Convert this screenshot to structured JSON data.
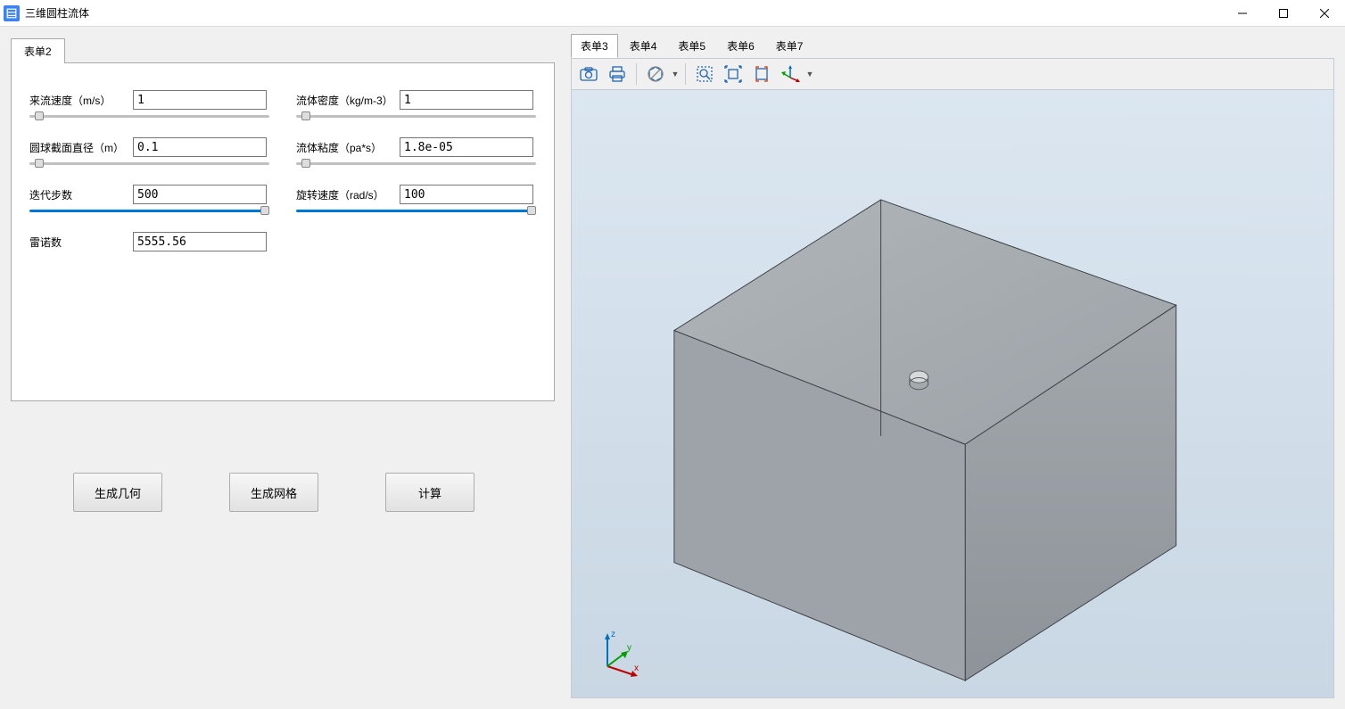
{
  "window": {
    "title": "三维圆柱流体"
  },
  "leftTab": {
    "label": "表单2"
  },
  "fields": {
    "velocity": {
      "label": "来流速度（m/s）",
      "value": "1",
      "sliderPos": "4%",
      "active": false
    },
    "density": {
      "label": "流体密度（kg/m-3）",
      "value": "1",
      "sliderPos": "4%",
      "active": false
    },
    "diameter": {
      "label": "圆球截面直径（m）",
      "value": "0.1",
      "sliderPos": "4%",
      "active": false
    },
    "viscosity": {
      "label": "流体粘度（pa*s）",
      "value": "1.8e-05",
      "sliderPos": "4%",
      "active": false
    },
    "iterations": {
      "label": "迭代步数",
      "value": "500",
      "sliderPos": "98%",
      "active": true
    },
    "rotation": {
      "label": "旋转速度（rad/s）",
      "value": "100",
      "sliderPos": "98%",
      "active": true
    },
    "reynolds": {
      "label": "雷诺数",
      "value": "5555.56"
    }
  },
  "buttons": {
    "genGeometry": "生成几何",
    "genMesh": "生成网格",
    "compute": "计算"
  },
  "rightTabs": [
    "表单3",
    "表单4",
    "表单5",
    "表单6",
    "表单7"
  ],
  "activeRightTab": 0,
  "axes": {
    "x": "x",
    "y": "y",
    "z": "z"
  }
}
